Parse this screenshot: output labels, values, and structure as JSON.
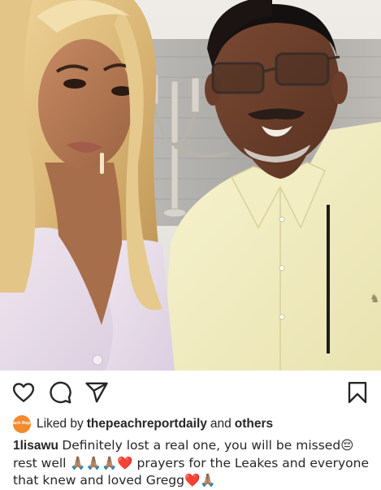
{
  "post": {
    "liked_by_prefix": "Liked by",
    "liked_by_user": "thepeachreportdaily",
    "liked_by_joiner": "and",
    "liked_by_others": "others",
    "avatar_text": "Peach Report",
    "caption_username": "1lisawu",
    "caption_text": "Definitely lost a real one, you will be missed😔rest well 🙏🏽🙏🏽🙏🏽❤️ prayers for the Leakes and everyone that knew and loved Gregg❤️🙏🏽"
  },
  "icons": {
    "like": "heart-icon",
    "comment": "comment-bubble-icon",
    "share": "paper-plane-icon",
    "save": "bookmark-icon"
  },
  "colors": {
    "text": "#262626",
    "avatar": "#f28a2e",
    "shirt": "#f3efc4"
  }
}
